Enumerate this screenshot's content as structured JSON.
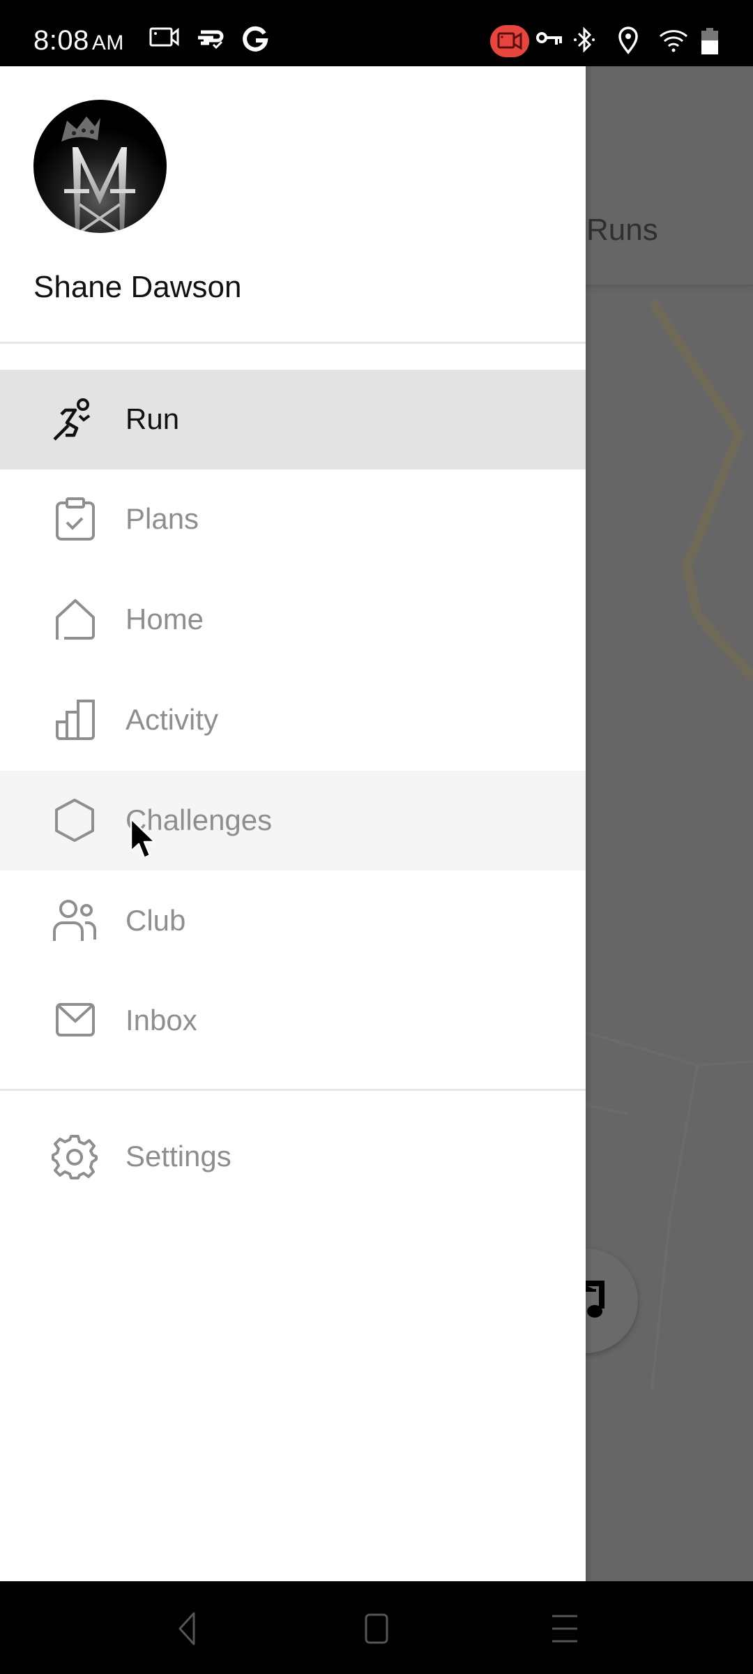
{
  "status_bar": {
    "time": "8:08",
    "ampm": "AM",
    "left_icons": [
      "screen-record-icon",
      "sync-check-icon",
      "google-icon"
    ],
    "right_icons": [
      "recording-active-icon",
      "vpn-key-icon",
      "bluetooth-icon",
      "location-icon",
      "wifi-icon",
      "battery-icon"
    ],
    "recording_color": "#e8453c"
  },
  "background_app": {
    "title_partial": "Runs",
    "route_color": "#7a6e4f"
  },
  "drawer": {
    "user": {
      "name": "Shane Dawson",
      "avatar_letter": "M"
    },
    "menu_items": [
      {
        "label": "Run",
        "icon": "runner-icon",
        "active": true
      },
      {
        "label": "Plans",
        "icon": "clipboard-check-icon",
        "active": false
      },
      {
        "label": "Home",
        "icon": "home-icon",
        "active": false
      },
      {
        "label": "Activity",
        "icon": "bar-chart-icon",
        "active": false
      },
      {
        "label": "Challenges",
        "icon": "hexagon-icon",
        "active": false,
        "hovered": true
      },
      {
        "label": "Club",
        "icon": "people-icon",
        "active": false
      },
      {
        "label": "Inbox",
        "icon": "envelope-icon",
        "active": false
      }
    ],
    "footer_items": [
      {
        "label": "Settings",
        "icon": "gear-icon"
      }
    ],
    "colors": {
      "active_bg": "#e3e3e3",
      "hover_bg": "#f5f5f5",
      "active_text": "#111111",
      "inactive_text": "#8e8e8e"
    }
  },
  "nav_bar": {
    "buttons": [
      "back",
      "home",
      "recents"
    ]
  }
}
